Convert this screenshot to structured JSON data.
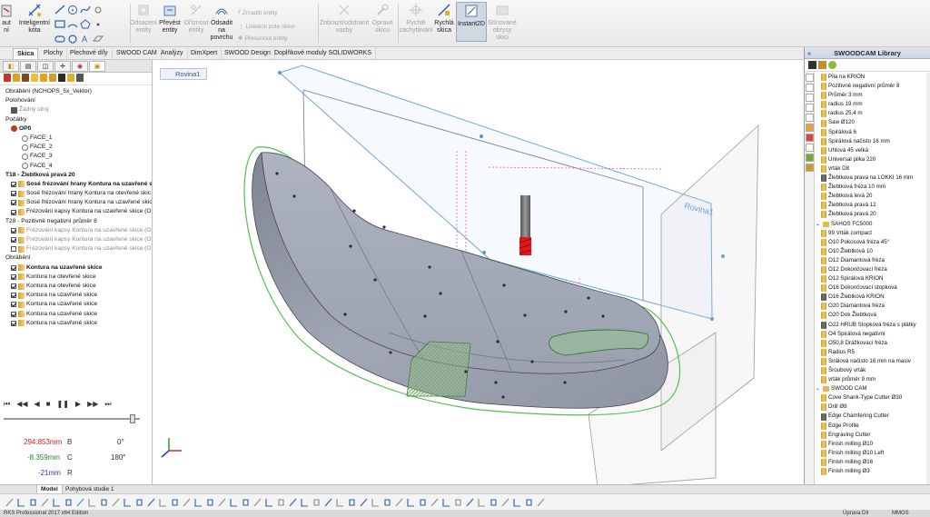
{
  "ribbon": {
    "left_partial": {
      "line1": "aut",
      "line2": "ní"
    },
    "smart_dim": {
      "line1": "Inteligentní",
      "line2": "kóta"
    },
    "offset_entities": {
      "line1": "Odsazení",
      "line2": "entity"
    },
    "convert_entities": {
      "line1": "Převést",
      "line2": "entity"
    },
    "trim_entities": {
      "line1": "Oříznout",
      "line2": "entity"
    },
    "convert_surface": {
      "line1": "Odsadit",
      "line2": "na",
      "line3": "povrchu"
    },
    "mirror_entities": "Zrcadlit entity",
    "linear_pattern": "Lineární pole skice",
    "move_entities": "Přesunout entity",
    "display_relations": {
      "line1": "Zobrazit/odstranit",
      "line2": "vazby"
    },
    "repair_sketch": {
      "line1": "Opravit",
      "line2": "skicu"
    },
    "quick_snaps": {
      "line1": "Rychlé",
      "line2": "zachytávání"
    },
    "rapid_sketch": {
      "line1": "Rychlá",
      "line2": "skica"
    },
    "instant2d": "Instant2D",
    "shaded_contours": {
      "line1": "Stínované",
      "line2": "obrysy",
      "line3": "skici"
    }
  },
  "command_tabs": [
    "Skica",
    "Plochy",
    "Plechové díly",
    "SWOOD CAM",
    "Analýzy",
    "DimXpert",
    "SWOOD Design",
    "Doplňkové moduly SOLIDWORKS"
  ],
  "active_tab": "Skica",
  "viewport": {
    "sketch_label": "Rovina1",
    "plane_label": "Rovina1"
  },
  "feature_tree": [
    {
      "text": "Obrábění (NCHOPS_5x_Vektor)",
      "indent": 0,
      "icon": "none",
      "style": ""
    },
    {
      "text": "Polohování",
      "indent": 0,
      "icon": "none",
      "style": ""
    },
    {
      "text": "Žádný stroj",
      "indent": 1,
      "icon": "machine",
      "style": "gray"
    },
    {
      "text": "Počátky",
      "indent": 0,
      "icon": "none",
      "style": ""
    },
    {
      "text": "OP0",
      "indent": 1,
      "icon": "origin",
      "style": "bold"
    },
    {
      "text": "FACE_1",
      "indent": 3,
      "icon": "face",
      "style": ""
    },
    {
      "text": "FACE_2",
      "indent": 3,
      "icon": "face",
      "style": ""
    },
    {
      "text": "FACE_3",
      "indent": 3,
      "icon": "face",
      "style": ""
    },
    {
      "text": "FACE_4",
      "indent": 3,
      "icon": "face",
      "style": ""
    },
    {
      "text": "T18 - Žlebtková pravá 20",
      "indent": 0,
      "icon": "none",
      "style": "bold"
    },
    {
      "text": "Sosé frézování hrany Kontura na uzavřené s",
      "indent": 1,
      "icon": "check",
      "style": "bold"
    },
    {
      "text": "Sosé frézování hrany Kontura na otevřené skic",
      "indent": 1,
      "icon": "check",
      "style": ""
    },
    {
      "text": "Sosé frézování hrany Kontura na uzavřené skic",
      "indent": 1,
      "icon": "check",
      "style": ""
    },
    {
      "text": "Frézování kapsy Kontura na uzavřené skice  (OI",
      "indent": 1,
      "icon": "check",
      "style": ""
    },
    {
      "text": "T28 - Pozitivně negativní průměr 8",
      "indent": 0,
      "icon": "none",
      "style": ""
    },
    {
      "text": "Frézování kapsy Kontura na uzavřené skice  (OI",
      "indent": 1,
      "icon": "check",
      "style": "gray"
    },
    {
      "text": "Frézování kapsy Kontura na uzavřené skice  (OI",
      "indent": 1,
      "icon": "check",
      "style": "gray"
    },
    {
      "text": "Frézování kapsy Kontura na uzavřené skice  (OI",
      "indent": 1,
      "icon": "empty",
      "style": "gray"
    },
    {
      "text": "Obrábění",
      "indent": 0,
      "icon": "none",
      "style": ""
    },
    {
      "text": "Kontura na uzavřené skice",
      "indent": 1,
      "icon": "check",
      "style": "bold"
    },
    {
      "text": "Kontura na otevřené skice",
      "indent": 1,
      "icon": "check",
      "style": ""
    },
    {
      "text": "Kontura na otevřené skice",
      "indent": 1,
      "icon": "check",
      "style": ""
    },
    {
      "text": "Kontura na uzavřené skice",
      "indent": 1,
      "icon": "check",
      "style": ""
    },
    {
      "text": "Kontura na uzavřené skice",
      "indent": 1,
      "icon": "check",
      "style": ""
    },
    {
      "text": "Kontura na uzavřené skice",
      "indent": 1,
      "icon": "check",
      "style": ""
    },
    {
      "text": "Kontura na uzavřené skice",
      "indent": 1,
      "icon": "check",
      "style": ""
    }
  ],
  "simulation": {
    "readouts": [
      {
        "value": "294.853mm",
        "axis": "B",
        "angle": "0°",
        "color": "#cc2222"
      },
      {
        "value": "-8.359mm",
        "axis": "C",
        "angle": "180°",
        "color": "#2a8a2a"
      },
      {
        "value": "-21mm",
        "axis": "R",
        "angle": "",
        "color": "#2a3fbf"
      }
    ]
  },
  "library": {
    "title": "SWOODCAM Library",
    "items": [
      {
        "text": "Pila na KRION",
        "type": "tool"
      },
      {
        "text": "Pozitivně negativní průměr 8",
        "type": "tool"
      },
      {
        "text": "Průměr 3 mm",
        "type": "tool"
      },
      {
        "text": "radius 19 mm",
        "type": "tool"
      },
      {
        "text": "radius 25,4 m",
        "type": "tool"
      },
      {
        "text": "Saw Ø120",
        "type": "tool"
      },
      {
        "text": "Spirálová 6",
        "type": "tool"
      },
      {
        "text": "Spirálová načisto 16 mm",
        "type": "tool"
      },
      {
        "text": "Uhlová 45 velká",
        "type": "tool"
      },
      {
        "text": "Universal pilka 220",
        "type": "tool"
      },
      {
        "text": "vrták D8",
        "type": "tool"
      },
      {
        "text": "Žlebtkova prava na LOKKI 16 mm",
        "type": "dark"
      },
      {
        "text": "Žlebtková fréza 10 mm",
        "type": "tool"
      },
      {
        "text": "Žlebtková levá 20",
        "type": "tool"
      },
      {
        "text": "Žlebtková pravá 12",
        "type": "tool"
      },
      {
        "text": "Žlebtková pravá 20",
        "type": "tool"
      },
      {
        "text": "SAHOS FC5000",
        "type": "group"
      },
      {
        "text": "99 Vrták compact",
        "type": "tool"
      },
      {
        "text": "O10 Pokosová fréza 45°",
        "type": "tool"
      },
      {
        "text": "O10 Žlebtková 10",
        "type": "tool"
      },
      {
        "text": "O12 Diamantová fréza",
        "type": "tool"
      },
      {
        "text": "O12 Dokončovací fréza",
        "type": "tool"
      },
      {
        "text": "O12 Spirálová KRION",
        "type": "tool"
      },
      {
        "text": "O16 Dokončovací stopková",
        "type": "tool"
      },
      {
        "text": "O16 Žlebtková KRION",
        "type": "dark"
      },
      {
        "text": "O20 Diamantová fréza",
        "type": "tool"
      },
      {
        "text": "O20 Dok Žlebtková",
        "type": "tool"
      },
      {
        "text": "O22 HRUB Stopková fréza s plátky",
        "type": "dark"
      },
      {
        "text": "O4 Spirálová negativní",
        "type": "tool"
      },
      {
        "text": "O50,8 Drážkovací fréza",
        "type": "tool"
      },
      {
        "text": "Radius R5",
        "type": "tool"
      },
      {
        "text": "Sirálová načisto 16 mm na masiv",
        "type": "tool"
      },
      {
        "text": "Šroubový vrták",
        "type": "tool"
      },
      {
        "text": "vrták průměr 9 mm",
        "type": "tool"
      },
      {
        "text": "SWOOD CAM",
        "type": "group"
      },
      {
        "text": "Cove Shank-Type Cutter Ø30",
        "type": "tool"
      },
      {
        "text": "Drill Ø8",
        "type": "tool"
      },
      {
        "text": "Edge Chamfering Cutter",
        "type": "dark"
      },
      {
        "text": "Edge Profile",
        "type": "tool"
      },
      {
        "text": "Engraving Cutter",
        "type": "tool"
      },
      {
        "text": "Finish milling Ø10",
        "type": "tool"
      },
      {
        "text": "Finish milling Ø10 Left",
        "type": "tool"
      },
      {
        "text": "Finish milling Ø16",
        "type": "tool"
      },
      {
        "text": "Finish milling Ø3",
        "type": "tool"
      }
    ]
  },
  "bottom_tabs": [
    "Model",
    "Pohybová studie 1"
  ],
  "status": {
    "left": "RKS Professional 2017 x64 Edition",
    "right1": "Úprava Díl",
    "right2": "MMGS"
  }
}
